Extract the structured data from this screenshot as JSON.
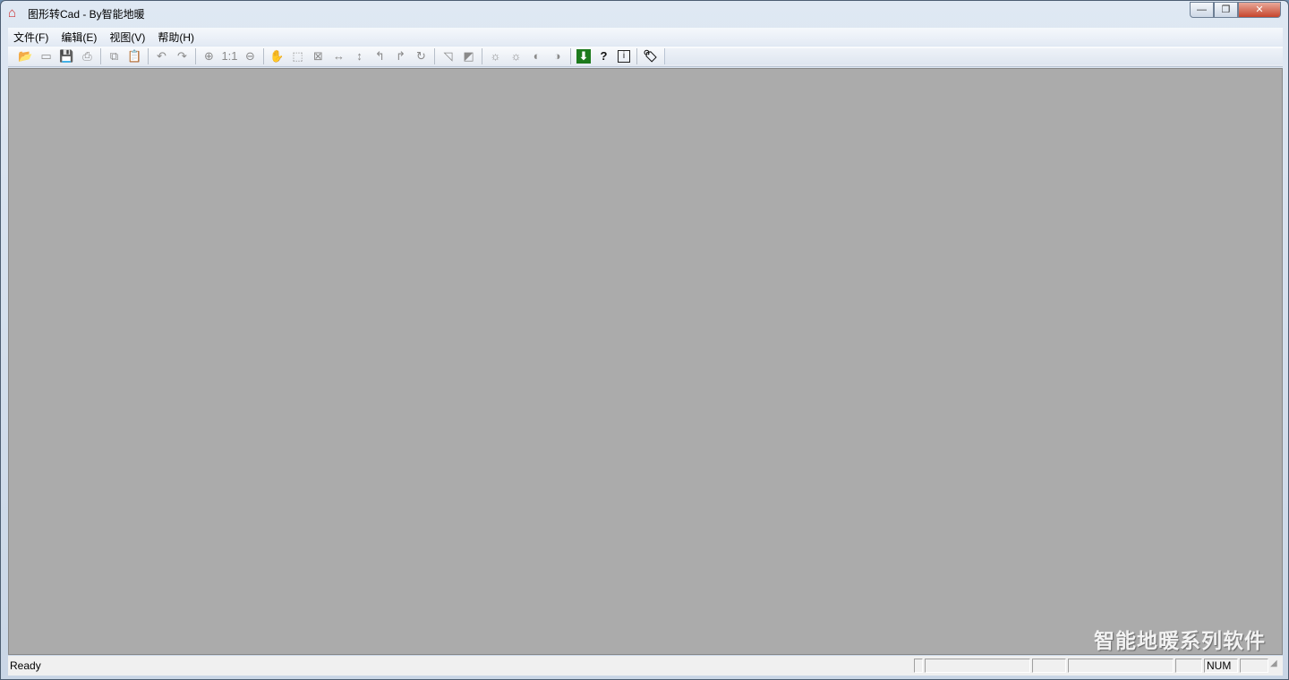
{
  "window": {
    "title": "图形转Cad - By智能地暖",
    "app_icon": "house-icon",
    "controls": {
      "minimize": "—",
      "maximize": "❐",
      "close": "✕"
    }
  },
  "menu": [
    "文件(F)",
    "编辑(E)",
    "视图(V)",
    "帮助(H)"
  ],
  "toolbar": [
    {
      "name": "open-icon",
      "glyph": "📂"
    },
    {
      "name": "new-icon",
      "glyph": "▭"
    },
    {
      "name": "save-icon",
      "glyph": "💾"
    },
    {
      "name": "print-icon",
      "glyph": "⎙"
    },
    "sep",
    {
      "name": "copy-icon",
      "glyph": "⧉"
    },
    {
      "name": "paste-icon",
      "glyph": "📋"
    },
    "sep",
    {
      "name": "undo-icon",
      "glyph": "↶"
    },
    {
      "name": "redo-icon",
      "glyph": "↷"
    },
    "sep",
    {
      "name": "zoom-in-icon",
      "glyph": "⊕"
    },
    {
      "name": "actual-size-icon",
      "glyph": "1:1"
    },
    {
      "name": "zoom-out-icon",
      "glyph": "⊖"
    },
    "sep",
    {
      "name": "pan-hand-icon",
      "glyph": "✋"
    },
    {
      "name": "select-rect-icon",
      "glyph": "⬚"
    },
    {
      "name": "delete-selection-icon",
      "glyph": "⊠"
    },
    {
      "name": "horizontal-arrows-icon",
      "glyph": "↔"
    },
    {
      "name": "vertical-arrows-icon",
      "glyph": "↕"
    },
    {
      "name": "rotate-left-icon",
      "glyph": "↰"
    },
    {
      "name": "rotate-right-icon",
      "glyph": "↱"
    },
    {
      "name": "rotate-icon",
      "glyph": "↻"
    },
    "sep",
    {
      "name": "triangle-outline-icon",
      "glyph": "◹"
    },
    {
      "name": "triangle-fill-icon",
      "glyph": "◩"
    },
    "sep",
    {
      "name": "light-up-icon",
      "glyph": "☼"
    },
    {
      "name": "light-down-icon",
      "glyph": "☼"
    },
    {
      "name": "contrast-up-icon",
      "glyph": "◐"
    },
    {
      "name": "contrast-down-icon",
      "glyph": "◑"
    },
    "sep",
    {
      "name": "download-icon",
      "glyph": "⬇",
      "style": "green"
    },
    {
      "name": "help-icon",
      "glyph": "?",
      "style": "dark"
    },
    {
      "name": "info-icon",
      "glyph": "i",
      "style": "info"
    },
    "sep",
    {
      "name": "tag-icon",
      "glyph": "🏷",
      "style": "dark"
    }
  ],
  "watermark": "智能地暖系列软件",
  "status": {
    "text": "Ready",
    "panes": [
      "",
      "",
      "",
      "",
      "",
      "NUM",
      ""
    ]
  }
}
